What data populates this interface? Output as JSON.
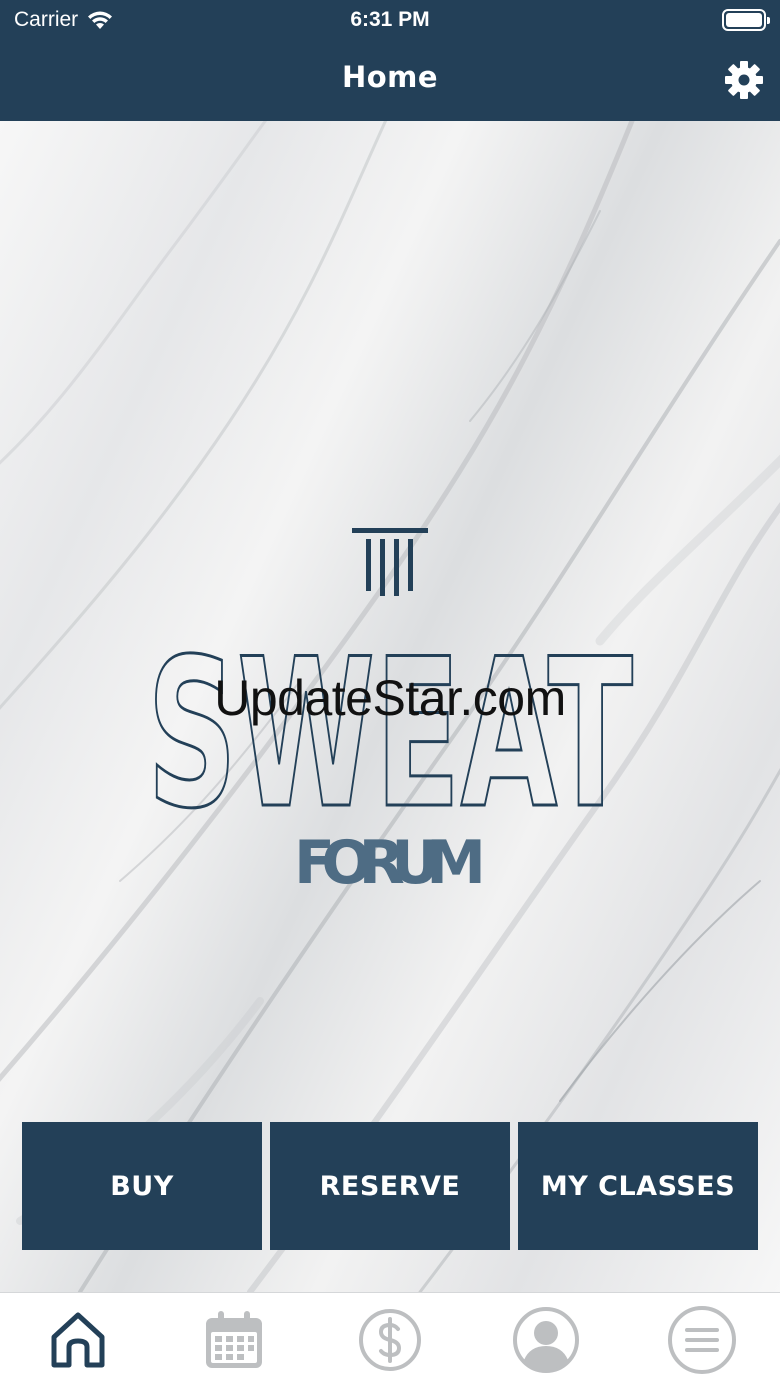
{
  "status_bar": {
    "carrier": "Carrier",
    "time": "6:31 PM"
  },
  "nav": {
    "title": "Home",
    "settings_icon": "gear-icon"
  },
  "logo": {
    "word": "SWEAT",
    "subword": "FORUM",
    "brand_color": "#234058"
  },
  "watermark": "UpdateStar.com",
  "actions": {
    "buy": "BUY",
    "reserve": "RESERVE",
    "my_classes": "MY CLASSES"
  },
  "tabs": [
    {
      "icon": "home-icon",
      "active": true
    },
    {
      "icon": "calendar-icon",
      "active": false
    },
    {
      "icon": "dollar-icon",
      "active": false
    },
    {
      "icon": "profile-icon",
      "active": false
    },
    {
      "icon": "menu-icon",
      "active": false
    }
  ],
  "colors": {
    "primary": "#234058",
    "tab_inactive": "#bdbfc1"
  }
}
